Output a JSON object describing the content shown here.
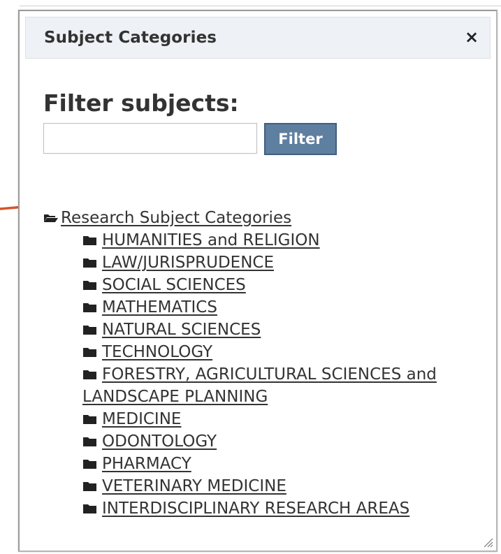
{
  "dialog": {
    "title": "Subject Categories",
    "close_glyph": "×",
    "icons": {
      "close": "close-icon",
      "folder_open": "folder-open-icon",
      "folder_closed": "folder-closed-icon",
      "resize": "resize-handle-icon",
      "pointer": "arrow-pointer-icon"
    }
  },
  "filter": {
    "heading": "Filter subjects:",
    "input_value": "",
    "input_placeholder": "",
    "button_label": "Filter"
  },
  "tree": {
    "root_label": "Research Subject Categories",
    "items": [
      "HUMANITIES and RELIGION",
      "LAW/JURISPRUDENCE",
      "SOCIAL SCIENCES",
      "MATHEMATICS",
      "NATURAL SCIENCES",
      "TECHNOLOGY",
      "FORESTRY, AGRICULTURAL SCIENCES and LANDSCAPE PLANNING",
      "MEDICINE",
      "ODONTOLOGY",
      "PHARMACY",
      "VETERINARY MEDICINE",
      "INTERDISCIPLINARY RESEARCH AREAS"
    ]
  },
  "colors": {
    "accent_button": "#5f7fa0",
    "titlebar_bg": "#eef1f5",
    "arrow": "#d4562a",
    "text": "#333333"
  }
}
